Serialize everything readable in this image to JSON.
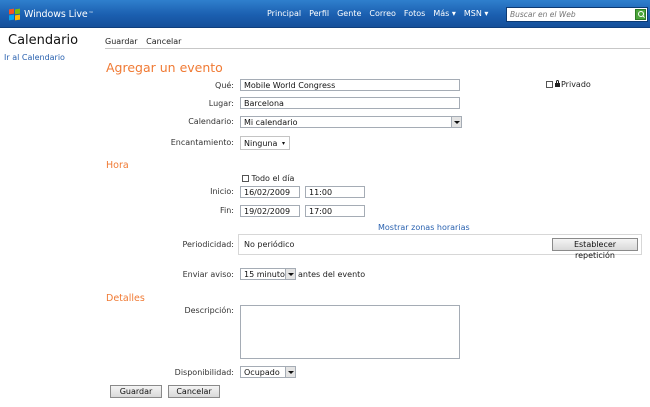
{
  "header": {
    "logo_text": "Windows Live",
    "logo_tm": "™",
    "nav": [
      "Principal",
      "Perfil",
      "Gente",
      "Correo",
      "Fotos",
      "Más ▾",
      "MSN ▾"
    ],
    "search_placeholder": "Buscar en el Web"
  },
  "sidebar": {
    "title": "Calendario",
    "link": "Ir al Calendario"
  },
  "toolbar": {
    "save": "Guardar",
    "cancel": "Cancelar"
  },
  "form": {
    "heading": "Agregar un evento",
    "que_label": "Qué:",
    "que_value": "Mobile World Congress",
    "privado_label": "Privado",
    "lugar_label": "Lugar:",
    "lugar_value": "Barcelona",
    "calendario_label": "Calendario:",
    "calendario_value": "Mi calendario",
    "encantamiento_label": "Encantamiento:",
    "encantamiento_value": "Ninguna"
  },
  "hora": {
    "heading": "Hora",
    "todo_el_dia": "Todo el día",
    "inicio_label": "Inicio:",
    "inicio_date": "16/02/2009",
    "inicio_time": "11:00",
    "fin_label": "Fin:",
    "fin_date": "19/02/2009",
    "fin_time": "17:00",
    "zonas_link": "Mostrar zonas horarias",
    "periodicidad_label": "Periodicidad:",
    "periodicidad_value": "No periódico",
    "repeticion_button": "Establecer repetición",
    "aviso_label": "Enviar aviso:",
    "aviso_value": "15 minutos",
    "aviso_suffix": "antes del evento"
  },
  "detalles": {
    "heading": "Detalles",
    "descripcion_label": "Descripción:",
    "disponibilidad_label": "Disponibilidad:",
    "disponibilidad_value": "Ocupado"
  },
  "footer": {
    "save": "Guardar",
    "cancel": "Cancelar"
  }
}
